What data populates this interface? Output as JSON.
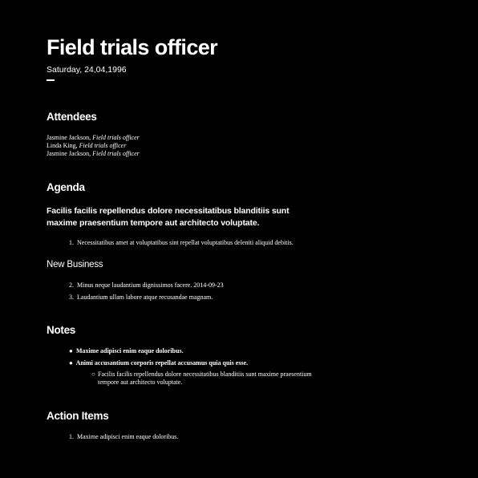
{
  "document": {
    "title": "Field trials officer",
    "date": "Saturday, 24,04,1996"
  },
  "attendees": {
    "heading": "Attendees",
    "people": [
      {
        "name": "Jasmine Jackson, ",
        "role": "Field trials officer"
      },
      {
        "name": "Linda King, ",
        "role": "Field trials officer"
      },
      {
        "name": "Jasmine Jackson, ",
        "role": "Field trials officer"
      }
    ]
  },
  "agenda": {
    "heading": "Agenda",
    "lead": "Facilis facilis repellendus dolore necessitatibus blanditiis sunt maxime praesentium tempore aut architecto voluptate.",
    "items": [
      {
        "number": "1.",
        "text": "Necessitatibus amet at voluptatibus sint repellat voluptatibus deleniti aliquid debitis."
      }
    ]
  },
  "new_business": {
    "heading": "New Business",
    "items": [
      {
        "number": "2.",
        "text": "Minus neque laudantium dignissimos facere. 2014-09-23"
      },
      {
        "number": "3.",
        "text": "Laudantium ullam labore atque recusandae magnam."
      }
    ]
  },
  "notes": {
    "heading": "Notes",
    "bullet_glyph": "●",
    "sub_bullet_glyph": "○",
    "items": [
      {
        "text": "Maxime adipisci enim eaque doloribus."
      },
      {
        "text": "Animi accusantium corporis repellat accusamus quia quis esse."
      }
    ],
    "sub_item": "Facilis facilis repellendus dolore necessitatibus blanditiis sunt maxime praesentium tempore aut architecto voluptate."
  },
  "action_items": {
    "heading": "Action Items",
    "items": [
      {
        "number": "1.",
        "text": "Maxime adipisci enim eaque doloribus."
      }
    ]
  },
  "colors": {
    "background": "#000000",
    "text": "#ffffff"
  }
}
